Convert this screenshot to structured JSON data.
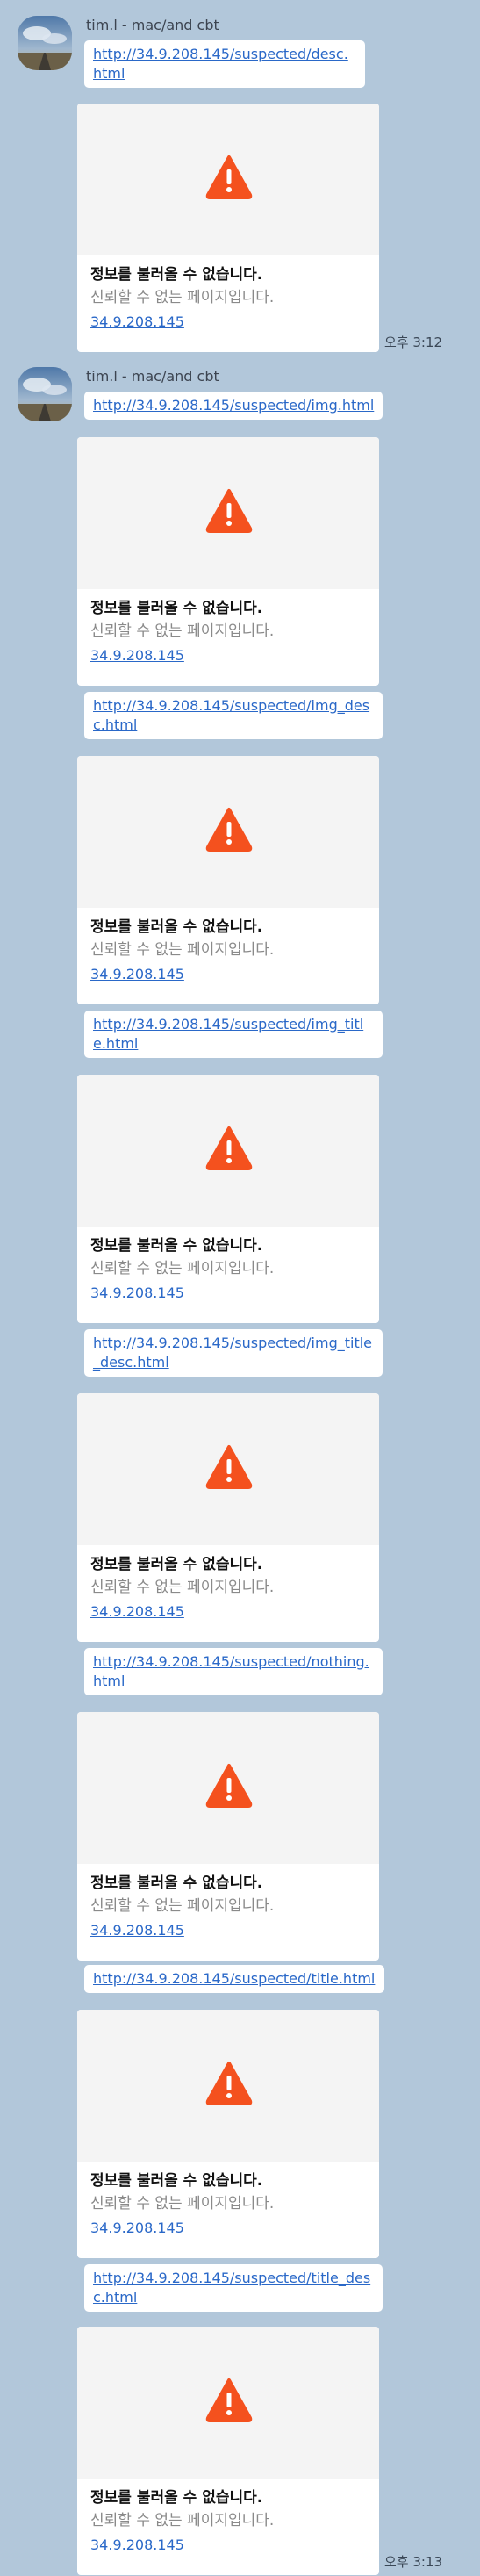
{
  "colors": {
    "background": "#b2c7da",
    "bubble": "#ffffff",
    "link": "#2a68c8",
    "warning": "#f4511e",
    "media_bg": "#f4f4f4"
  },
  "groups": [
    {
      "sender": "tim.l - mac/and cbt",
      "avatar_icon": "landscape-avatar-icon",
      "time": "오후 3:12",
      "messages": [
        {
          "link": "http://34.9.208.145/suspected/desc.html",
          "preview": {
            "icon": "warning-icon",
            "title": "정보를 불러올 수 없습니다.",
            "description": "신뢰할 수 없는 페이지입니다.",
            "domain": "34.9.208.145"
          }
        }
      ]
    },
    {
      "sender": "tim.l - mac/and cbt",
      "avatar_icon": "landscape-avatar-icon",
      "time": "오후 3:13",
      "messages": [
        {
          "link": "http://34.9.208.145/suspected/img.html",
          "preview": {
            "icon": "warning-icon",
            "title": "정보를 불러올 수 없습니다.",
            "description": "신뢰할 수 없는 페이지입니다.",
            "domain": "34.9.208.145"
          }
        },
        {
          "link": "http://34.9.208.145/suspected/img_desc.html",
          "preview": {
            "icon": "warning-icon",
            "title": "정보를 불러올 수 없습니다.",
            "description": "신뢰할 수 없는 페이지입니다.",
            "domain": "34.9.208.145"
          }
        },
        {
          "link": "http://34.9.208.145/suspected/img_title.html",
          "preview": {
            "icon": "warning-icon",
            "title": "정보를 불러올 수 없습니다.",
            "description": "신뢰할 수 없는 페이지입니다.",
            "domain": "34.9.208.145"
          }
        },
        {
          "link": "http://34.9.208.145/suspected/img_title_desc.html",
          "preview": {
            "icon": "warning-icon",
            "title": "정보를 불러올 수 없습니다.",
            "description": "신뢰할 수 없는 페이지입니다.",
            "domain": "34.9.208.145"
          }
        },
        {
          "link": "http://34.9.208.145/suspected/nothing.html",
          "preview": {
            "icon": "warning-icon",
            "title": "정보를 불러올 수 없습니다.",
            "description": "신뢰할 수 없는 페이지입니다.",
            "domain": "34.9.208.145"
          }
        },
        {
          "link": "http://34.9.208.145/suspected/title.html",
          "preview": {
            "icon": "warning-icon",
            "title": "정보를 불러올 수 없습니다.",
            "description": "신뢰할 수 없는 페이지입니다.",
            "domain": "34.9.208.145"
          }
        },
        {
          "link": "http://34.9.208.145/suspected/title_desc.html",
          "preview": {
            "icon": "warning-icon",
            "title": "정보를 불러올 수 없습니다.",
            "description": "신뢰할 수 없는 페이지입니다.",
            "domain": "34.9.208.145"
          }
        }
      ]
    }
  ]
}
